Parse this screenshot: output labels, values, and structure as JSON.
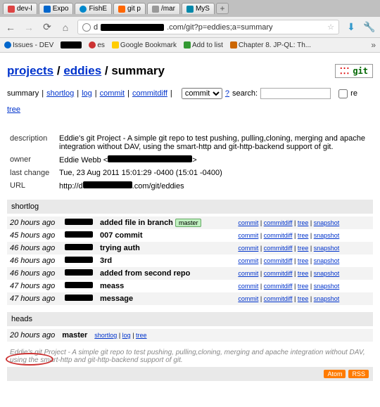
{
  "tabs": [
    {
      "label": "dev-l",
      "iconColor": "#d44"
    },
    {
      "label": "Expo",
      "iconColor": "#06c"
    },
    {
      "label": "FishE",
      "iconColor": "#08c"
    },
    {
      "label": "git p",
      "iconColor": "#f60"
    },
    {
      "label": "/mar",
      "iconColor": "#999"
    },
    {
      "label": "MyS",
      "iconColor": "#08a"
    }
  ],
  "url": {
    "prefix": "d",
    "suffix": ".com/git?p=eddies;a=summary"
  },
  "bookmarks": {
    "issues": "Issues - DEV",
    "es": "es",
    "google": "Google Bookmark",
    "addlist": "Add to list",
    "chapter": "Chapter 8. JP-QL: Th..."
  },
  "breadcrumb": {
    "projects": "projects",
    "repo": "eddies",
    "page": "summary"
  },
  "nav": {
    "summary": "summary",
    "shortlog": "shortlog",
    "log": "log",
    "commit": "commit",
    "commitdiff": "commitdiff",
    "tree": "tree",
    "dropdown": "commit",
    "qmark": "?",
    "search": "search:",
    "re": "re"
  },
  "desc": {
    "description_lbl": "description",
    "description_val": "Eddie's git Project - A simple git repo to test pushing, pulling,cloning, merging and apache integration without DAV, using the smart-http and git-http-backend support of git.",
    "owner_lbl": "owner",
    "owner_val": "Eddie Webb <",
    "owner_suffix": ">",
    "lastchange_lbl": "last change",
    "lastchange_val": "Tue, 23 Aug 2011 15:01:29 -0400 (15:01 -0400)",
    "url_lbl": "URL",
    "url_prefix": "http://d",
    "url_suffix": ".com/git/eddies"
  },
  "sections": {
    "shortlog": "shortlog",
    "heads": "heads"
  },
  "shortlog": [
    {
      "age": "20 hours ago",
      "msg": "added file in branch",
      "master": true
    },
    {
      "age": "45 hours ago",
      "msg": "007 commit"
    },
    {
      "age": "46 hours ago",
      "msg": "trying auth"
    },
    {
      "age": "46 hours ago",
      "msg": "3rd"
    },
    {
      "age": "46 hours ago",
      "msg": "added from second repo"
    },
    {
      "age": "47 hours ago",
      "msg": "meass"
    },
    {
      "age": "47 hours ago",
      "msg": "message"
    }
  ],
  "action_labels": {
    "commit": "commit",
    "commitdiff": "commitdiff",
    "tree": "tree",
    "snapshot": "snapshot",
    "shortlog": "shortlog",
    "log": "log"
  },
  "heads": {
    "age": "20 hours ago",
    "name": "master"
  },
  "footer": "Eddie's git Project - A simple git repo to test pushing, pulling,cloning, merging and apache integration without DAV, using the smart-http and git-http-backend support of git.",
  "feeds": {
    "atom": "Atom",
    "rss": "RSS"
  },
  "tag": {
    "master": "master"
  }
}
